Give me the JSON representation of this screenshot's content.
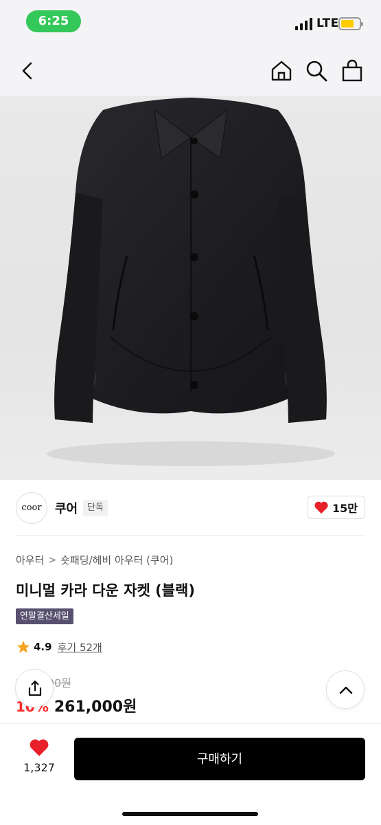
{
  "status_bar": {
    "time": "6:25",
    "network": "LTE",
    "battery_color": "#ffcc00",
    "pill_color": "#34c759"
  },
  "nav": {
    "icons": [
      "back-arrow-icon",
      "home-icon",
      "search-icon",
      "shopping-bag-icon"
    ]
  },
  "brand": {
    "logo_text": "coor",
    "name": "쿠어",
    "badge": "단독",
    "likes": "15만"
  },
  "breadcrumb": {
    "category": "아우터",
    "separator": ">",
    "subcategory": "숏패딩/헤비 아우터 (쿠어)"
  },
  "product": {
    "title": "미니멀 카라 다운 자켓 (블랙)",
    "sale_tag": "연말결산세일",
    "rating": "4.9",
    "reviews": "후기 52개",
    "original_price": "290,000원",
    "discount": "10%",
    "price": "261,000원"
  },
  "bottom": {
    "wish_count": "1,327",
    "buy_label": "구매하기"
  },
  "colors": {
    "accent_red": "#ff2d2d",
    "heart": "#e8202a",
    "tag": "#57506e",
    "star": "#f5a623"
  }
}
